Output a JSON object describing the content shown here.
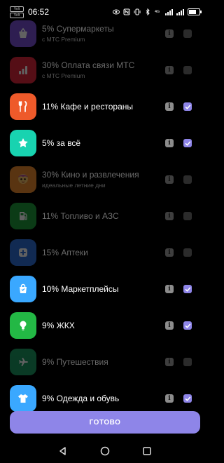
{
  "status_bar": {
    "time": "06:52",
    "sim_labels": [
      "Volt",
      "Volt"
    ],
    "battery_level": 0.85
  },
  "items": [
    {
      "title": "5% Супермаркеты",
      "subtitle": "с МТС Premium",
      "enabled": false,
      "checked": false,
      "icon": "basket-icon",
      "color": "#7a4fd6"
    },
    {
      "title": "30% Оплата связи МТС",
      "subtitle": "с МТС Premium",
      "enabled": false,
      "checked": false,
      "icon": "signal-bars-icon",
      "color": "#e0263a"
    },
    {
      "title": "11% Кафе и рестораны",
      "subtitle": "",
      "enabled": true,
      "checked": true,
      "icon": "fork-knife-icon",
      "color": "#ee5a2a"
    },
    {
      "title": "5% за всё",
      "subtitle": "",
      "enabled": true,
      "checked": true,
      "icon": "star-icon",
      "color": "#18d3b0"
    },
    {
      "title": "30% Кино и развлечения",
      "subtitle": "идеальные летние дни",
      "enabled": false,
      "checked": false,
      "icon": "cartoon-character-icon",
      "color": "#e98a2f"
    },
    {
      "title": "11% Топливо и АЗС",
      "subtitle": "",
      "enabled": false,
      "checked": false,
      "icon": "fuel-pump-icon",
      "color": "#1e9c3a"
    },
    {
      "title": "15% Аптеки",
      "subtitle": "",
      "enabled": false,
      "checked": false,
      "icon": "pharmacy-cross-icon",
      "color": "#2f6fd8"
    },
    {
      "title": "10% Маркетплейсы",
      "subtitle": "",
      "enabled": true,
      "checked": true,
      "icon": "shopping-bag-icon",
      "color": "#3aa8ff"
    },
    {
      "title": "9% ЖКХ",
      "subtitle": "",
      "enabled": true,
      "checked": true,
      "icon": "light-bulb-icon",
      "color": "#23b845"
    },
    {
      "title": "9% Путешествия",
      "subtitle": "",
      "enabled": false,
      "checked": false,
      "icon": "airplane-icon",
      "color": "#1b9a62"
    },
    {
      "title": "9% Одежда и обувь",
      "subtitle": "",
      "enabled": true,
      "checked": true,
      "icon": "t-shirt-icon",
      "color": "#3aa8ff"
    }
  ],
  "info_glyph": "i",
  "done_button": "ГОТОВО",
  "colors": {
    "accent": "#8e85e8",
    "background": "#000000"
  }
}
